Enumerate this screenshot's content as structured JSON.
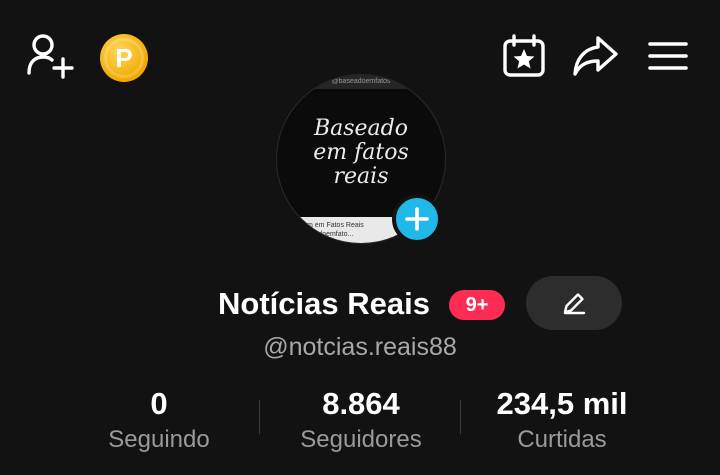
{
  "header": {
    "add_friend_icon": "person-plus-icon",
    "coin_letter": "P",
    "calendar_icon": "calendar-star-icon",
    "share_icon": "share-arrow-icon",
    "menu_icon": "hamburger-icon"
  },
  "avatar": {
    "top_text": "@baseadoemfatos",
    "script_text_line1": "Baseado",
    "script_text_line2": "em fatos",
    "script_text_line3": "reais",
    "bottom_text_line1": "m em Fatos Reais",
    "bottom_text_line2": "seadoemfato..."
  },
  "profile": {
    "name": "Notícias Reais",
    "badge": "9+",
    "username": "@notcias.reais88"
  },
  "stats": [
    {
      "value": "0",
      "label": "Seguindo"
    },
    {
      "value": "8.864",
      "label": "Seguidores"
    },
    {
      "value": "234,5 mil",
      "label": "Curtidas"
    }
  ],
  "colors": {
    "background": "#121212",
    "badge": "#fe2c55",
    "add_avatar": "#20b8e8",
    "coin": "#f2a900"
  }
}
